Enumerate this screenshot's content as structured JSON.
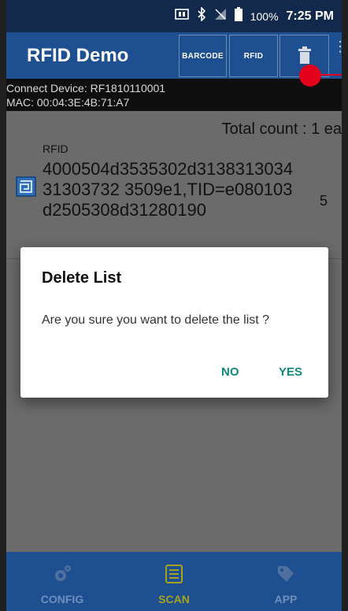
{
  "status_bar": {
    "battery_percent": "100%",
    "time": "7:25 PM",
    "icons": [
      "nfc-icon",
      "bluetooth-icon",
      "no-signal-icon",
      "battery-icon"
    ]
  },
  "app_bar": {
    "title": "RFID Demo",
    "barcode_label": "BARCODE",
    "rfid_label": "RFID",
    "delete_icon": "trash-icon",
    "more_icon": "more-vert-icon"
  },
  "device_info": {
    "connect_line": "Connect Device: RF1810110001",
    "mac_line": "MAC: 00:04:3E:4B:71:A7"
  },
  "list": {
    "total_count": "Total count : 1 ea",
    "items": [
      {
        "type": "RFID",
        "epc": "4000504d3535302d313831303431303732 3509e1,TID=e080103d2505308d31280190",
        "count": "5"
      }
    ]
  },
  "dialog": {
    "title": "Delete List",
    "message": "Are you sure you want to delete the list ?",
    "no_label": "NO",
    "yes_label": "YES"
  },
  "bottom_nav": {
    "items": [
      {
        "label": "CONFIG",
        "icon": "gear-icon"
      },
      {
        "label": "SCAN",
        "icon": "scan-list-icon",
        "active": true
      },
      {
        "label": "APP",
        "icon": "app-tag-icon"
      }
    ]
  },
  "colors": {
    "app_bar": "#1d4f91",
    "status_bar": "#13294b",
    "dialog_button": "#0e8a7e",
    "active_nav": "#a7a21c",
    "annotation": "#e3001b"
  }
}
